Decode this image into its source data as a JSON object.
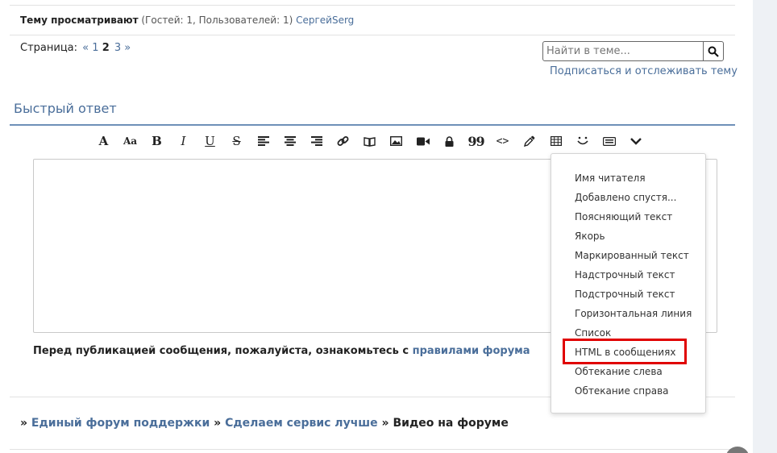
{
  "viewing": {
    "label": "Тему просматривают",
    "counts": "(Гостей: 1, Пользователей: 1)",
    "user": "СергейSerg"
  },
  "pager": {
    "label": "Страница:",
    "prev": "«",
    "pages": [
      "1",
      "2",
      "3"
    ],
    "current": "2",
    "next": "»"
  },
  "search": {
    "placeholder": "Найти в теме..."
  },
  "subscribe": "Подписаться и отслеживать тему",
  "quick_reply": {
    "title": "Быстрый ответ"
  },
  "toolbar": {
    "font": "A",
    "size": "Aa",
    "bold": "B",
    "italic": "I",
    "underline": "U",
    "strike": "S",
    "quote": "99",
    "code": "<>"
  },
  "dropdown": {
    "items": [
      "Имя читателя",
      "Добавлено спустя...",
      "Поясняющий текст",
      "Якорь",
      "Маркированный текст",
      "Надстрочный текст",
      "Подстрочный текст",
      "Горизонтальная линия",
      "Список",
      "HTML в сообщениях",
      "Обтекание слева",
      "Обтекание справа"
    ]
  },
  "notice": {
    "text": "Перед публикацией сообщения, пожалуйста, ознакомьтесь с",
    "link": "правилами форума"
  },
  "breadcrumbs": {
    "sep": "»",
    "item1": "Единый форум поддержки",
    "item2": "Сделаем сервис лучше",
    "current": "Видео на форуме"
  },
  "colors": {
    "link": "#4a6e9a",
    "highlight": "#e00000"
  }
}
